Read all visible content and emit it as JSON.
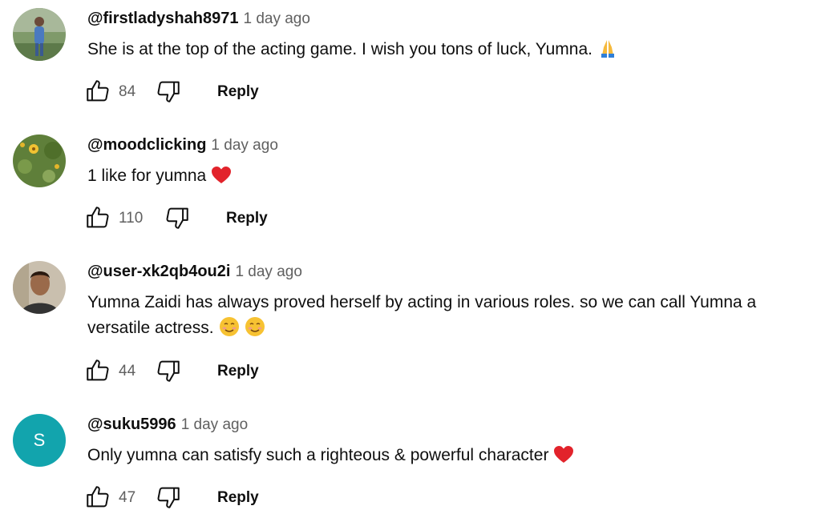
{
  "comments": [
    {
      "author": "@firstladyshah8971",
      "time": "1 day ago",
      "text": "She is at the top of the acting game. I wish you tons of luck, Yumna.",
      "emoji": "folded-hands-icon",
      "likes": "84",
      "reply_label": "Reply",
      "avatar": "profile-photo"
    },
    {
      "author": "@moodclicking",
      "time": "1 day ago",
      "text": "1 like for yumna",
      "emoji": "red-heart-icon",
      "likes": "110",
      "reply_label": "Reply",
      "avatar": "flower-photo"
    },
    {
      "author": "@user-xk2qb4ou2i",
      "time": "1 day ago",
      "text": "Yumna Zaidi has always proved herself by acting in various roles. so we can call Yumna a versatile actress.",
      "emoji": "smiling-face-icon",
      "likes": "44",
      "reply_label": "Reply",
      "avatar": "profile-photo"
    },
    {
      "author": "@suku5996",
      "time": "1 day ago",
      "text": "Only yumna can satisfy such a righteous & powerful character",
      "emoji": "red-heart-icon",
      "likes": "47",
      "reply_label": "Reply",
      "avatar_letter": "S",
      "avatar_color": "#12a4ad"
    }
  ],
  "colors": {
    "primary_text": "#0f0f0f",
    "secondary_text": "#606060",
    "avatar_letter_bg": "#12a4ad"
  }
}
